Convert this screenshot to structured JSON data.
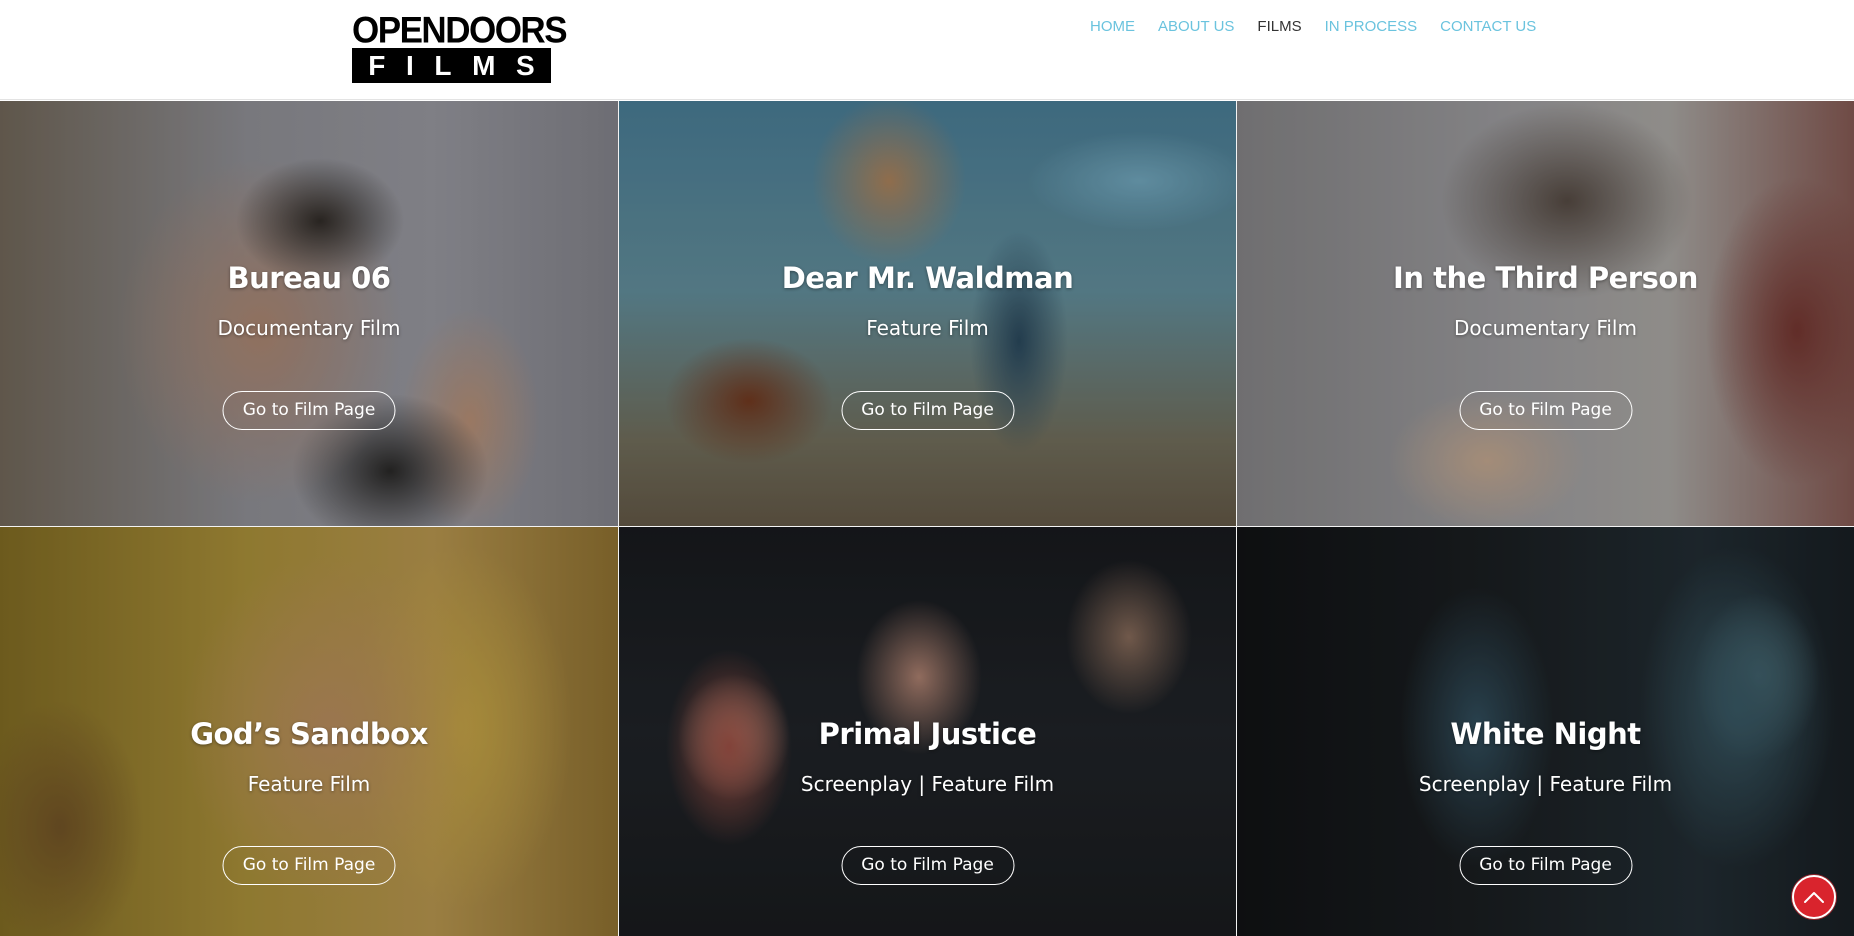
{
  "header": {
    "logo": {
      "line1": "OPENDOORS",
      "line2": [
        "F",
        "I",
        "L",
        "M",
        "S"
      ]
    },
    "nav": [
      {
        "label": "HOME",
        "active": false
      },
      {
        "label": "ABOUT US",
        "active": false
      },
      {
        "label": "FILMS",
        "active": true
      },
      {
        "label": "IN PROCESS",
        "active": false
      },
      {
        "label": "CONTACT US",
        "active": false
      }
    ],
    "nav_color": "#6ac3de",
    "nav_active_color": "#333333"
  },
  "films": [
    {
      "title": "Bureau 06",
      "type": "Documentary Film",
      "button": "Go to Film Page"
    },
    {
      "title": "Dear Mr. Waldman",
      "type": "Feature Film",
      "button": "Go to Film Page"
    },
    {
      "title": "In the Third Person",
      "type": "Documentary Film",
      "button": "Go to Film Page"
    },
    {
      "title": "God’s Sandbox",
      "type": "Feature Film",
      "button": "Go to Film Page"
    },
    {
      "title": "Primal Justice",
      "type": "Screenplay | Feature Film",
      "button": "Go to Film Page"
    },
    {
      "title": "White Night",
      "type": "Screenplay | Feature Film",
      "button": "Go to Film Page"
    }
  ],
  "scroll_top": {
    "icon": "chevron-up-icon",
    "color": "#d9242d"
  }
}
